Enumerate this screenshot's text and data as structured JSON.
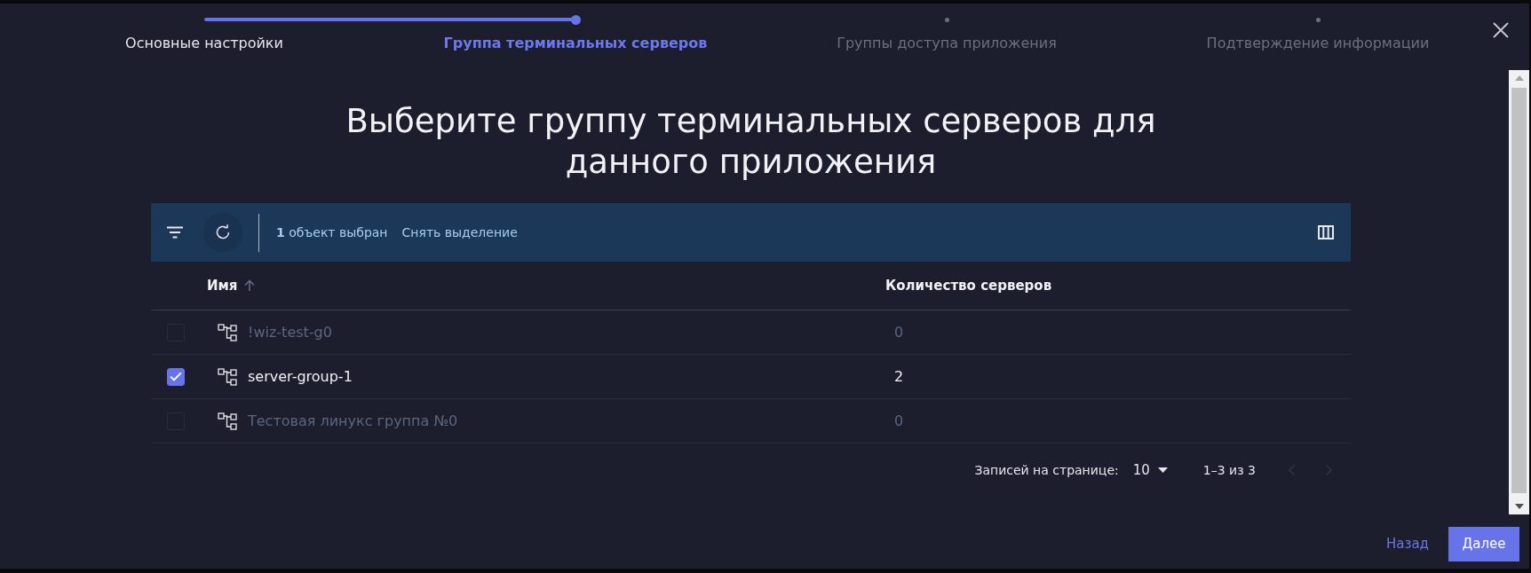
{
  "stepper": {
    "steps": [
      {
        "label": "Основные настройки",
        "completed": true,
        "current": false
      },
      {
        "label": "Группа терминальных серверов",
        "completed": false,
        "current": true
      },
      {
        "label": "Группы доступа приложения",
        "completed": false,
        "current": false
      },
      {
        "label": "Подтверждение информации",
        "completed": false,
        "current": false
      }
    ]
  },
  "heading": "Выберите группу терминальных серверов для данного приложения",
  "table": {
    "toolbar": {
      "selection": "**1** объект выбран",
      "clear_selection": "Снять выделение"
    },
    "columns": [
      {
        "label": "Имя",
        "sorted": true
      },
      {
        "label": "Количество серверов",
        "sorted": false
      }
    ],
    "rows": [
      {
        "name": "!wiz-test-g0",
        "servers": "0",
        "selected": false,
        "disabled": true
      },
      {
        "name": "server-group-1",
        "servers": "2",
        "selected": true,
        "disabled": false
      },
      {
        "name": "Тестовая линукс группа №0",
        "servers": "0",
        "selected": false,
        "disabled": true
      }
    ],
    "pagination": {
      "rows_per_page_label": "Записей на странице:",
      "rows_per_page": "10",
      "range": "1–3 из 3",
      "previous": {
        "disabled": true
      },
      "next": {
        "disabled": true
      }
    }
  },
  "footer": {
    "buttons": [
      {
        "label": "Назад",
        "kind": "link"
      },
      {
        "label": "Далее",
        "kind": "primary"
      }
    ]
  }
}
